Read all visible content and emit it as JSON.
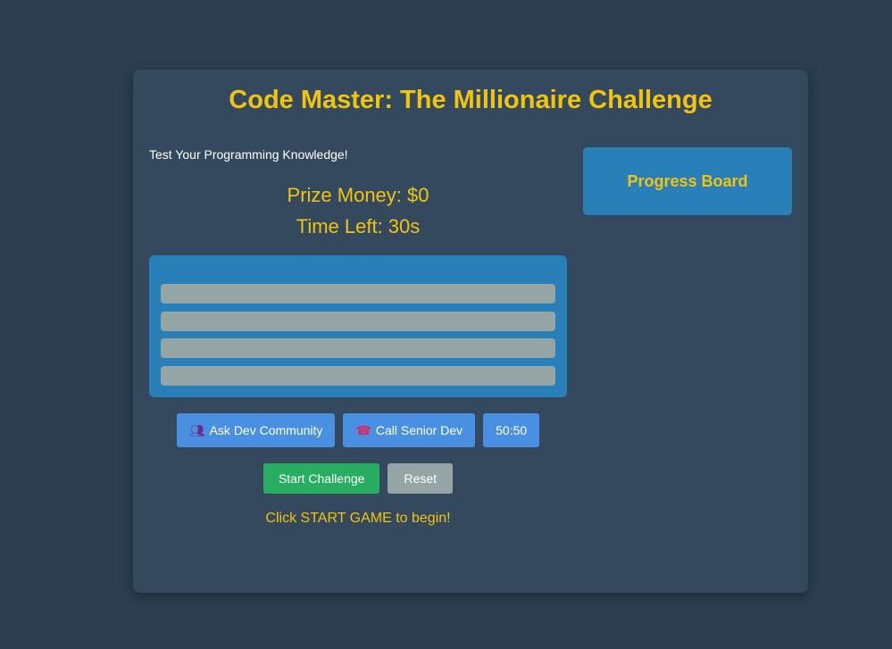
{
  "game": {
    "title": "Code Master: The Millionaire Challenge",
    "subtitle": "Test Your Programming Knowledge!",
    "prize_label": "Prize Money: $0",
    "timer_label": "Time Left: 30s",
    "question": "",
    "answers": [
      "",
      "",
      "",
      ""
    ],
    "message": "Click START GAME to begin!"
  },
  "lifelines": {
    "ask_community": {
      "icon": "people-icon",
      "label": "Ask Dev Community"
    },
    "call_senior": {
      "icon": "phone-icon",
      "label": "Call Senior Dev"
    },
    "fifty_fifty": {
      "label": "50:50"
    }
  },
  "controls": {
    "start_label": "Start Challenge",
    "reset_label": "Reset"
  },
  "progress_board": {
    "title": "Progress Board"
  },
  "colors": {
    "background": "#2c3e50",
    "card": "#34495e",
    "accent_yellow": "#f1c40f",
    "panel_blue": "#2980b9",
    "lifeline_blue": "#4a90e2",
    "start_green": "#27ae60",
    "neutral_gray": "#95a5a6"
  }
}
